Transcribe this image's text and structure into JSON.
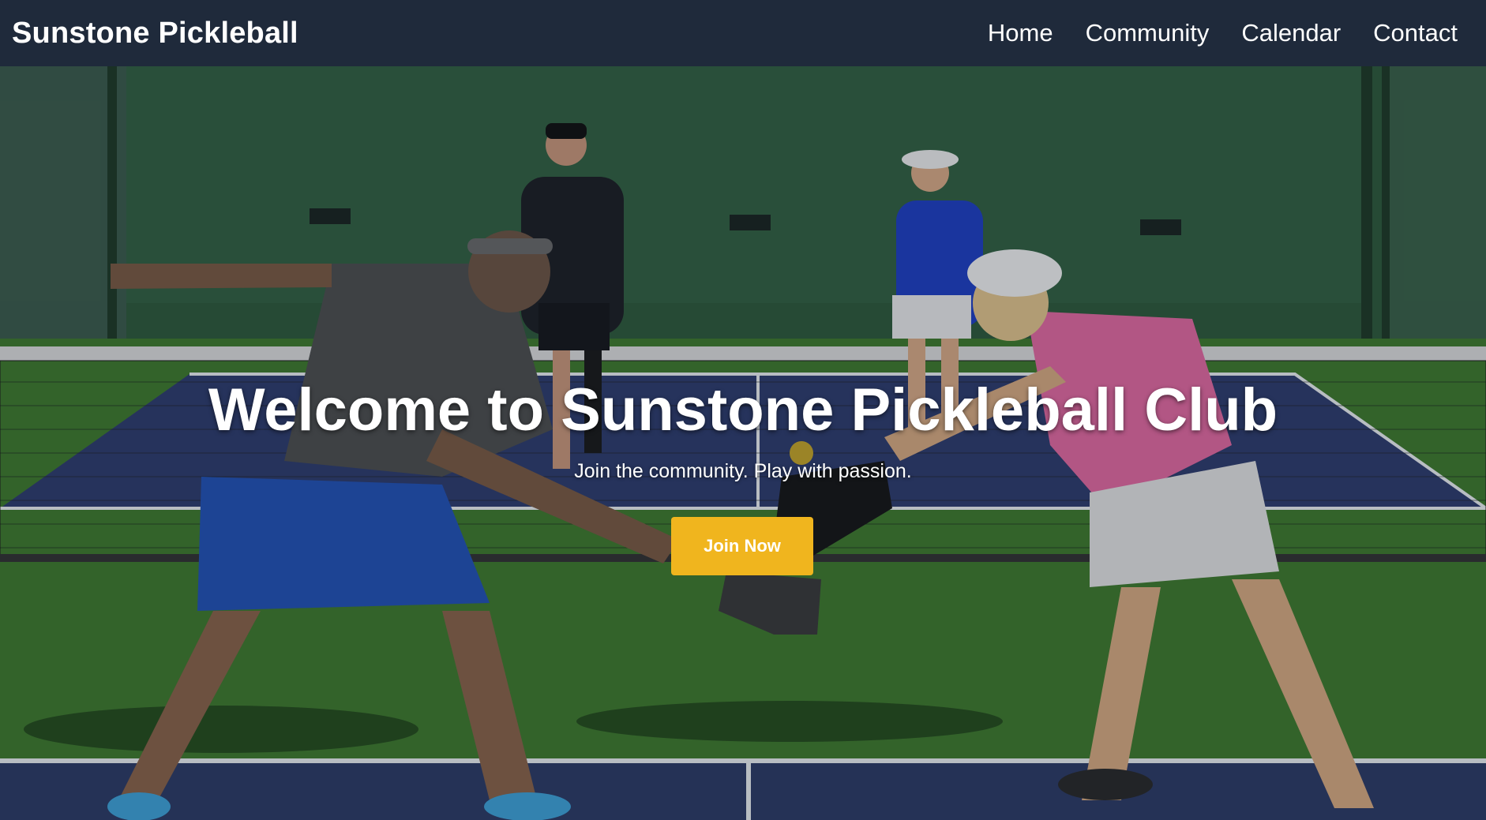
{
  "navbar": {
    "brand": "Sunstone Pickleball",
    "links": [
      "Home",
      "Community",
      "Calendar",
      "Contact"
    ]
  },
  "hero": {
    "title": "Welcome to Sunstone Pickleball Club",
    "subtitle": "Join the community. Play with passion.",
    "cta_label": "Join Now",
    "background_image": "pickleball-doubles-match-photo"
  },
  "colors": {
    "navbar_bg": "#1f2a3b",
    "cta_bg": "#f0b51e",
    "court_green": "#3f7a2e",
    "court_blue": "#2f3d6e"
  }
}
